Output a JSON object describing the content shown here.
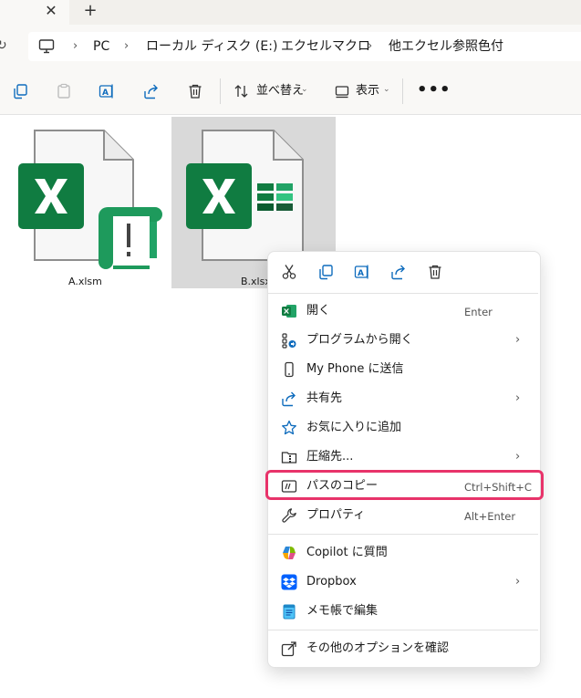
{
  "tabs": {
    "close_glyph": "✕",
    "new_glyph": "+"
  },
  "address": {
    "icon": "pc-icon",
    "breadcrumbs": [
      "PC",
      "ローカル ディスク (E:)",
      "エクセルマクロ",
      "他エクセル参照色付"
    ],
    "separator": "›"
  },
  "commandbar": {
    "icons": [
      "copy-icon",
      "paste-icon",
      "rename-icon",
      "share-icon",
      "delete-icon"
    ],
    "sort_label": "並べ替え",
    "view_label": "表示",
    "more": "•••"
  },
  "files": [
    {
      "name": "A.xlsm",
      "icon": "excel-macro-file-icon",
      "selected": false
    },
    {
      "name": "B.xlsx",
      "icon": "excel-file-icon",
      "selected": true
    }
  ],
  "context_menu": {
    "top_icons": [
      "cut-icon",
      "copy-icon",
      "rename-icon",
      "share-icon",
      "delete-icon"
    ],
    "items": [
      {
        "label": "開く",
        "shortcut": "Enter",
        "icon": "excel-icon",
        "submenu": false
      },
      {
        "label": "プログラムから開く",
        "shortcut": "",
        "icon": "open-with-icon",
        "submenu": true
      },
      {
        "label": "My Phone に送信",
        "shortcut": "",
        "icon": "phone-icon",
        "submenu": false
      },
      {
        "label": "共有先",
        "shortcut": "",
        "icon": "share-icon",
        "submenu": true
      },
      {
        "label": "お気に入りに追加",
        "shortcut": "",
        "icon": "star-icon",
        "submenu": false
      },
      {
        "label": "圧縮先...",
        "shortcut": "",
        "icon": "zip-folder-icon",
        "submenu": true
      },
      {
        "label": "パスのコピー",
        "shortcut": "Ctrl+Shift+C",
        "icon": "copy-path-icon",
        "submenu": false,
        "highlighted": true
      },
      {
        "label": "プロパティ",
        "shortcut": "Alt+Enter",
        "icon": "wrench-icon",
        "submenu": false
      },
      {
        "label": "Copilot に質問",
        "shortcut": "",
        "icon": "copilot-icon",
        "submenu": false
      },
      {
        "label": "Dropbox",
        "shortcut": "",
        "icon": "dropbox-icon",
        "submenu": true
      },
      {
        "label": "メモ帳で編集",
        "shortcut": "",
        "icon": "notepad-icon",
        "submenu": false
      },
      {
        "label": "その他のオプションを確認",
        "shortcut": "",
        "icon": "more-options-icon",
        "submenu": false
      }
    ],
    "highlight_color": "#e8336a"
  },
  "colors": {
    "excel_green": "#107c41",
    "excel_light": "#21a366",
    "accent": "#0f6cbd"
  }
}
